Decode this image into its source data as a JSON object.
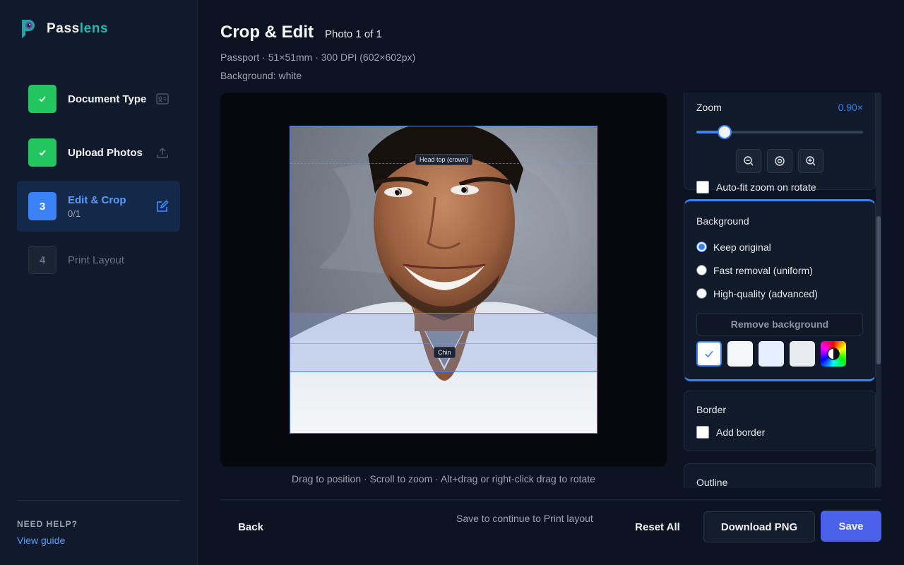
{
  "app": {
    "name_part1": "Pass",
    "name_part2": "lens"
  },
  "steps": [
    {
      "label": "Document Type",
      "state": "done",
      "icon": "id-card-icon"
    },
    {
      "label": "Upload Photos",
      "state": "done",
      "icon": "upload-icon"
    },
    {
      "number": "3",
      "label": "Edit & Crop",
      "sub": "0/1",
      "state": "active",
      "icon": "edit-icon"
    },
    {
      "number": "4",
      "label": "Print Layout",
      "state": "pending"
    }
  ],
  "help": {
    "title": "NEED HELP?",
    "link": "View guide"
  },
  "header": {
    "title": "Crop & Edit",
    "counter": "Photo 1 of 1",
    "spec": "Passport · 51×51mm · 300 DPI (602×602px)",
    "background": "Background: white"
  },
  "canvas": {
    "guide_top": "Head top (crown)",
    "guide_chin": "Chin",
    "hint": "Drag to position · Scroll to zoom · Alt+drag or right-click drag to rotate"
  },
  "zoom": {
    "label": "Zoom",
    "value": "0.90×",
    "level_fraction": 0.17,
    "autofit_label": "Auto-fit zoom on rotate"
  },
  "background_panel": {
    "title": "Background",
    "options": [
      "Keep original",
      "Fast removal (uniform)",
      "High-quality (advanced)"
    ],
    "selected": 0,
    "remove_button": "Remove background",
    "swatches": [
      "#ffffff",
      "#f5f6f8",
      "#e6efff",
      "#e9ebf0"
    ]
  },
  "border_panel": {
    "title": "Border",
    "add_label": "Add border"
  },
  "outline_panel": {
    "title": "Outline"
  },
  "footer": {
    "back": "Back",
    "save_hint": "Save to continue to Print layout",
    "reset": "Reset All",
    "download": "Download PNG",
    "save": "Save"
  },
  "colors": {
    "accent": "#3b82f6",
    "success": "#22c55e",
    "primary_button": "#4a62ea",
    "brand_teal": "#2bb5b0"
  }
}
